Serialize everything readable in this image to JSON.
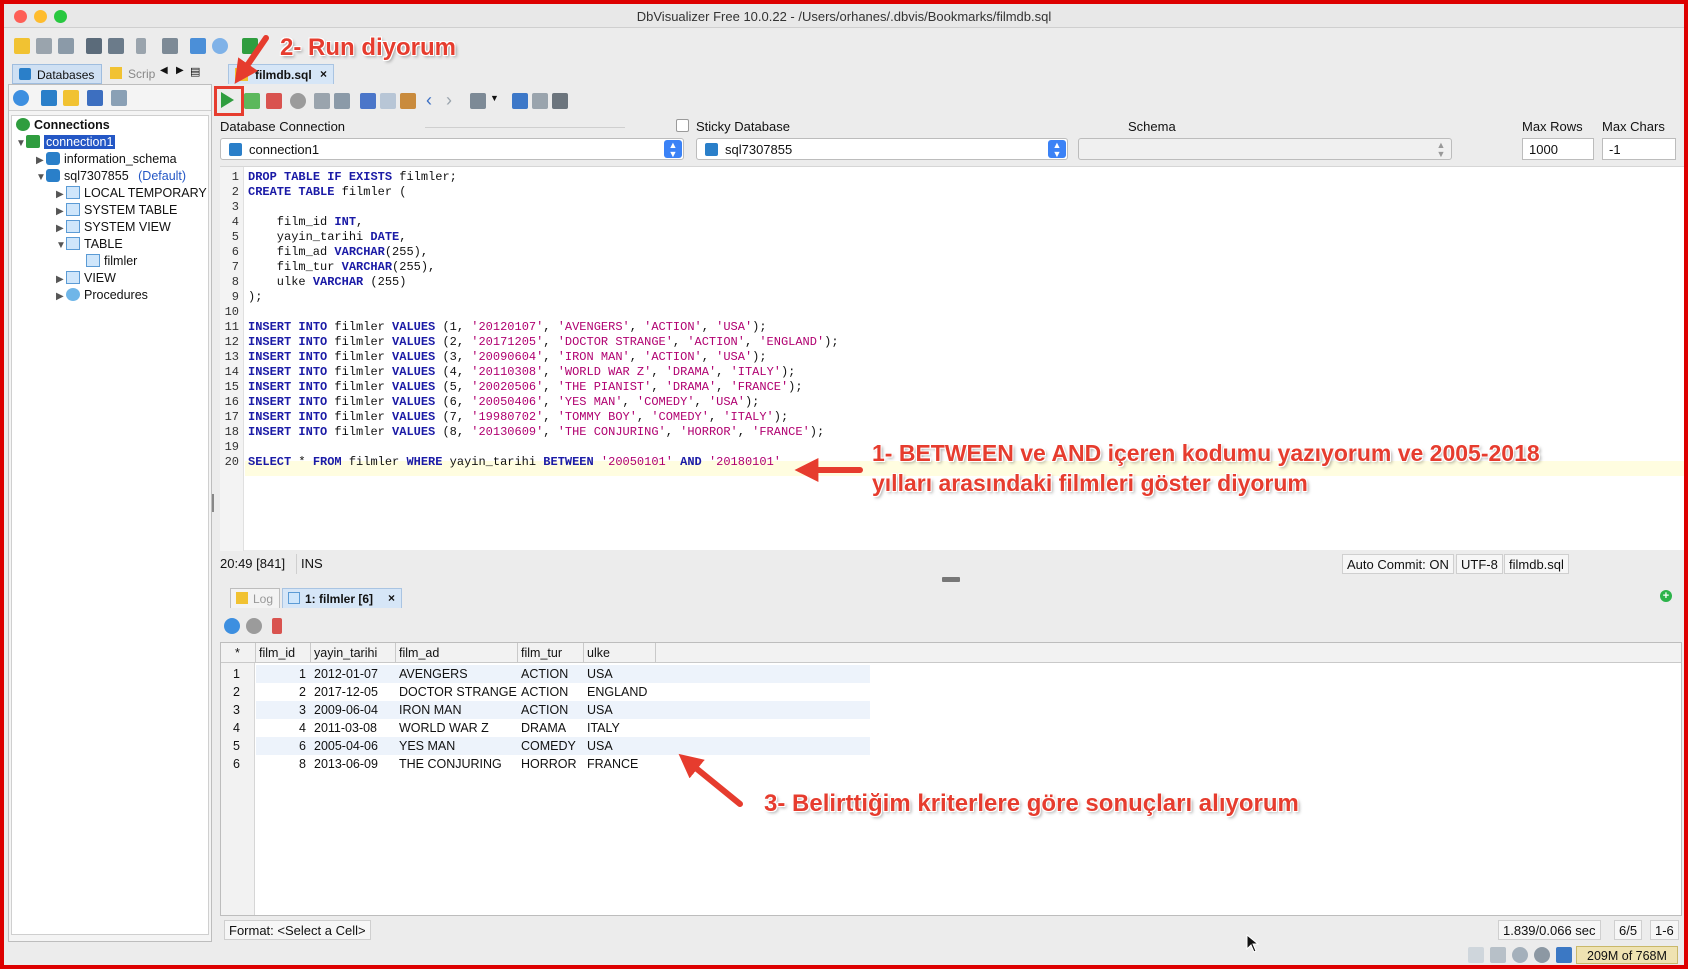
{
  "window": {
    "title": "DbVisualizer Free 10.0.22 - /Users/orhanes/.dbvis/Bookmarks/filmdb.sql"
  },
  "left_tabs": {
    "databases": "Databases",
    "scripts": "Scrip"
  },
  "tree": {
    "root": "Connections",
    "connection": "connection1",
    "info_schema": "information_schema",
    "schema": "sql7307855",
    "default_tag": "(Default)",
    "local_temp": "LOCAL TEMPORARY",
    "system_table": "SYSTEM TABLE",
    "system_view": "SYSTEM VIEW",
    "table": "TABLE",
    "filmler": "filmler",
    "view": "VIEW",
    "procedures": "Procedures"
  },
  "editor_tab": {
    "label": "filmdb.sql",
    "close": "×"
  },
  "connection_bar": {
    "db_conn_label": "Database Connection",
    "sticky_label": "Sticky Database",
    "schema_label": "Schema",
    "max_rows_label": "Max Rows",
    "max_chars_label": "Max Chars",
    "connection_value": "connection1",
    "database_value": "sql7307855",
    "max_rows_value": "1000",
    "max_chars_value": "-1"
  },
  "code_lines": [
    "DROP TABLE IF EXISTS filmler;",
    "CREATE TABLE filmler (",
    "",
    "    film_id INT,",
    "    yayin_tarihi DATE,",
    "    film_ad VARCHAR(255),",
    "    film_tur VARCHAR(255),",
    "    ulke VARCHAR (255)",
    ");",
    "",
    "INSERT INTO filmler VALUES (1, '20120107', 'AVENGERS', 'ACTION', 'USA');",
    "INSERT INTO filmler VALUES (2, '20171205', 'DOCTOR STRANGE', 'ACTION', 'ENGLAND');",
    "INSERT INTO filmler VALUES (3, '20090604', 'IRON MAN', 'ACTION', 'USA');",
    "INSERT INTO filmler VALUES (4, '20110308', 'WORLD WAR Z', 'DRAMA', 'ITALY');",
    "INSERT INTO filmler VALUES (5, '20020506', 'THE PIANIST', 'DRAMA', 'FRANCE');",
    "INSERT INTO filmler VALUES (6, '20050406', 'YES MAN', 'COMEDY', 'USA');",
    "INSERT INTO filmler VALUES (7, '19980702', 'TOMMY BOY', 'COMEDY', 'ITALY');",
    "INSERT INTO filmler VALUES (8, '20130609', 'THE CONJURING', 'HORROR', 'FRANCE');",
    "",
    "SELECT * FROM filmler WHERE yayin_tarihi BETWEEN '20050101' AND '20180101'"
  ],
  "editor_status": {
    "position": "20:49 [841]",
    "mode": "INS",
    "autocommit": "Auto Commit: ON",
    "encoding": "UTF-8",
    "file": "filmdb.sql"
  },
  "result_tabs": {
    "log": "Log",
    "result": "1: filmler [6]",
    "close": "×",
    "add": "+"
  },
  "grid": {
    "corner": "*",
    "columns": [
      "film_id",
      "yayin_tarihi",
      "film_ad",
      "film_tur",
      "ulke"
    ],
    "rows": [
      {
        "n": "1",
        "film_id": "1",
        "yayin_tarihi": "2012-01-07",
        "film_ad": "AVENGERS",
        "film_tur": "ACTION",
        "ulke": "USA"
      },
      {
        "n": "2",
        "film_id": "2",
        "yayin_tarihi": "2017-12-05",
        "film_ad": "DOCTOR STRANGE",
        "film_tur": "ACTION",
        "ulke": "ENGLAND"
      },
      {
        "n": "3",
        "film_id": "3",
        "yayin_tarihi": "2009-06-04",
        "film_ad": "IRON MAN",
        "film_tur": "ACTION",
        "ulke": "USA"
      },
      {
        "n": "4",
        "film_id": "4",
        "yayin_tarihi": "2011-03-08",
        "film_ad": "WORLD WAR Z",
        "film_tur": "DRAMA",
        "ulke": "ITALY"
      },
      {
        "n": "5",
        "film_id": "6",
        "yayin_tarihi": "2005-04-06",
        "film_ad": "YES MAN",
        "film_tur": "COMEDY",
        "ulke": "USA"
      },
      {
        "n": "6",
        "film_id": "8",
        "yayin_tarihi": "2013-06-09",
        "film_ad": "THE CONJURING",
        "film_tur": "HORROR",
        "ulke": "FRANCE"
      }
    ]
  },
  "result_status": {
    "format": "Format: <Select a Cell>",
    "timing": "1.839/0.066 sec",
    "rows": "6/5",
    "range": "1-6"
  },
  "memory": "209M of 768M",
  "annotations": {
    "run": "2- Run diyorum",
    "between_1": "1- BETWEEN ve AND içeren kodumu yazıyorum ve 2005-2018",
    "between_2": "yılları arasındaki filmleri göster diyorum",
    "results": "3- Belirttiğim kriterlere göre sonuçları alıyorum"
  },
  "colors": {
    "accent_red": "#e63c2e",
    "selection_blue": "#2457c5",
    "keyword": "#1a1aa6",
    "string": "#b00070"
  },
  "icons": [
    "folder-icon",
    "save-icon",
    "run-icon",
    "stop-icon",
    "cut-icon",
    "copy-icon",
    "paste-icon",
    "back-icon",
    "forward-icon",
    "refresh-icon",
    "export-icon"
  ]
}
